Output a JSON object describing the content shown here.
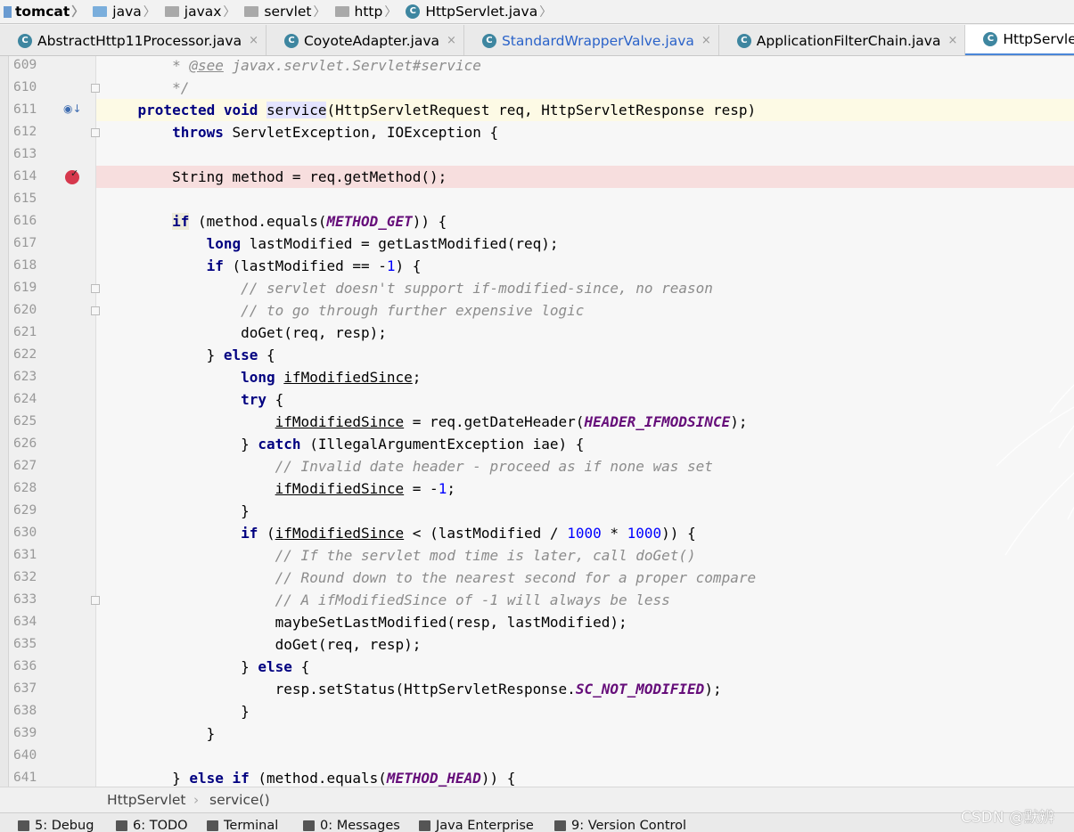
{
  "breadcrumb": [
    {
      "label": "tomcat",
      "kind": "project"
    },
    {
      "label": "java",
      "kind": "folder"
    },
    {
      "label": "javax",
      "kind": "package"
    },
    {
      "label": "servlet",
      "kind": "package"
    },
    {
      "label": "http",
      "kind": "package"
    },
    {
      "label": "HttpServlet.java",
      "kind": "class"
    }
  ],
  "tabs": [
    {
      "label": "AbstractHttp11Processor.java",
      "active": false,
      "linked": false
    },
    {
      "label": "CoyoteAdapter.java",
      "active": false,
      "linked": false
    },
    {
      "label": "StandardWrapperValve.java",
      "active": false,
      "linked": true
    },
    {
      "label": "ApplicationFilterChain.java",
      "active": false,
      "linked": false
    },
    {
      "label": "HttpServlet.java",
      "active": true,
      "linked": false
    }
  ],
  "tab_close_glyph": "×",
  "class_icon_letter": "C",
  "lines": [
    {
      "n": "609",
      "tokens": [
        [
          "cm",
          "        * "
        ],
        [
          "tagj",
          "@see"
        ],
        [
          "cm",
          " javax.servlet.Servlet#service"
        ]
      ]
    },
    {
      "n": "610",
      "tokens": [
        [
          "cm",
          "        */"
        ]
      ]
    },
    {
      "n": "611",
      "tokens": [
        [
          "",
          "    "
        ],
        [
          "kw",
          "protected void "
        ],
        [
          "mark2",
          "service"
        ],
        [
          "",
          "(HttpServletRequest req, HttpServletResponse resp)"
        ]
      ]
    },
    {
      "n": "612",
      "tokens": [
        [
          "",
          "        "
        ],
        [
          "kw",
          "throws "
        ],
        [
          "",
          "ServletException, IOException {"
        ]
      ]
    },
    {
      "n": "613",
      "tokens": []
    },
    {
      "n": "614",
      "tokens": [
        [
          "",
          "        String method = req.getMethod();"
        ]
      ]
    },
    {
      "n": "615",
      "tokens": []
    },
    {
      "n": "616",
      "tokens": [
        [
          "",
          "        "
        ],
        [
          "kwmark",
          "if"
        ],
        [
          "",
          " (method.equals("
        ],
        [
          "cst",
          "METHOD_GET"
        ],
        [
          "",
          "))"
        ],
        [
          "",
          " {"
        ]
      ]
    },
    {
      "n": "617",
      "tokens": [
        [
          "",
          "            "
        ],
        [
          "kw",
          "long "
        ],
        [
          "",
          "lastModified = getLastModified(req);"
        ]
      ]
    },
    {
      "n": "618",
      "tokens": [
        [
          "",
          "            "
        ],
        [
          "kw",
          "if "
        ],
        [
          "",
          "(lastModified == -"
        ],
        [
          "num",
          "1"
        ],
        [
          "",
          ") {"
        ]
      ]
    },
    {
      "n": "619",
      "tokens": [
        [
          "",
          "                "
        ],
        [
          "cm",
          "// servlet doesn't support if-modified-since, no reason"
        ]
      ]
    },
    {
      "n": "620",
      "tokens": [
        [
          "",
          "                "
        ],
        [
          "cm",
          "// to go through further expensive logic"
        ]
      ]
    },
    {
      "n": "621",
      "tokens": [
        [
          "",
          "                doGet(req, resp);"
        ]
      ]
    },
    {
      "n": "622",
      "tokens": [
        [
          "",
          "            } "
        ],
        [
          "kw",
          "else "
        ],
        [
          "",
          "{"
        ]
      ]
    },
    {
      "n": "623",
      "tokens": [
        [
          "",
          "                "
        ],
        [
          "kw",
          "long "
        ],
        [
          "ul",
          "ifModifiedSince"
        ],
        [
          "",
          ";"
        ]
      ]
    },
    {
      "n": "624",
      "tokens": [
        [
          "",
          "                "
        ],
        [
          "kw",
          "try "
        ],
        [
          "",
          "{"
        ]
      ]
    },
    {
      "n": "625",
      "tokens": [
        [
          "",
          "                    "
        ],
        [
          "ul",
          "ifModifiedSince"
        ],
        [
          "",
          " = req.getDateHeader("
        ],
        [
          "cst",
          "HEADER_IFMODSINCE"
        ],
        [
          "",
          ");"
        ]
      ]
    },
    {
      "n": "626",
      "tokens": [
        [
          "",
          "                } "
        ],
        [
          "kw",
          "catch "
        ],
        [
          "",
          "(IllegalArgumentException iae) {"
        ]
      ]
    },
    {
      "n": "627",
      "tokens": [
        [
          "",
          "                    "
        ],
        [
          "cm",
          "// Invalid date header - proceed as if none was set"
        ]
      ]
    },
    {
      "n": "628",
      "tokens": [
        [
          "",
          "                    "
        ],
        [
          "ul",
          "ifModifiedSince"
        ],
        [
          "",
          " = -"
        ],
        [
          "num",
          "1"
        ],
        [
          "",
          ";"
        ]
      ]
    },
    {
      "n": "629",
      "tokens": [
        [
          "",
          "                }"
        ]
      ]
    },
    {
      "n": "630",
      "tokens": [
        [
          "",
          "                "
        ],
        [
          "kw",
          "if "
        ],
        [
          "",
          "("
        ],
        [
          "ul",
          "ifModifiedSince"
        ],
        [
          "",
          " < (lastModified / "
        ],
        [
          "num",
          "1000"
        ],
        [
          "",
          " * "
        ],
        [
          "num",
          "1000"
        ],
        [
          "",
          ")) {"
        ]
      ]
    },
    {
      "n": "631",
      "tokens": [
        [
          "",
          "                    "
        ],
        [
          "cm",
          "// If the servlet mod time is later, call doGet()"
        ]
      ]
    },
    {
      "n": "632",
      "tokens": [
        [
          "",
          "                    "
        ],
        [
          "cm",
          "// Round down to the nearest second for a proper compare"
        ]
      ]
    },
    {
      "n": "633",
      "tokens": [
        [
          "",
          "                    "
        ],
        [
          "cm",
          "// A ifModifiedSince of -1 will always be less"
        ]
      ]
    },
    {
      "n": "634",
      "tokens": [
        [
          "",
          "                    maybeSetLastModified(resp, lastModified);"
        ]
      ]
    },
    {
      "n": "635",
      "tokens": [
        [
          "",
          "                    doGet(req, resp);"
        ]
      ]
    },
    {
      "n": "636",
      "tokens": [
        [
          "",
          "                } "
        ],
        [
          "kw",
          "else "
        ],
        [
          "",
          "{"
        ]
      ]
    },
    {
      "n": "637",
      "tokens": [
        [
          "",
          "                    resp.setStatus(HttpServletResponse."
        ],
        [
          "cst",
          "SC_NOT_MODIFIED"
        ],
        [
          "",
          ");"
        ]
      ]
    },
    {
      "n": "638",
      "tokens": [
        [
          "",
          "                }"
        ]
      ]
    },
    {
      "n": "639",
      "tokens": [
        [
          "",
          "            }"
        ]
      ]
    },
    {
      "n": "640",
      "tokens": []
    },
    {
      "n": "641",
      "tokens": [
        [
          "",
          "        } "
        ],
        [
          "kw",
          "else if "
        ],
        [
          "",
          "(method.equals("
        ],
        [
          "cst",
          "METHOD_HEAD"
        ],
        [
          "",
          ")) {"
        ]
      ]
    }
  ],
  "code_breadcrumb": {
    "class": "HttpServlet",
    "separator": "›",
    "method": "service()"
  },
  "toolwindows": [
    {
      "label": "5: Debug"
    },
    {
      "label": "6: TODO"
    },
    {
      "label": "Terminal"
    },
    {
      "label": "0: Messages"
    },
    {
      "label": "Java Enterprise"
    },
    {
      "label": "9: Version Control"
    }
  ],
  "watermark_text": "CSDN @默辨",
  "colors": {
    "keyword": "#000080",
    "comment": "#8c8c8c",
    "constant": "#660e7a",
    "number": "#0000ff",
    "breakpoint": "#d6384d",
    "current_line": "#fdfae5",
    "breakpoint_line": "#f7dede"
  }
}
